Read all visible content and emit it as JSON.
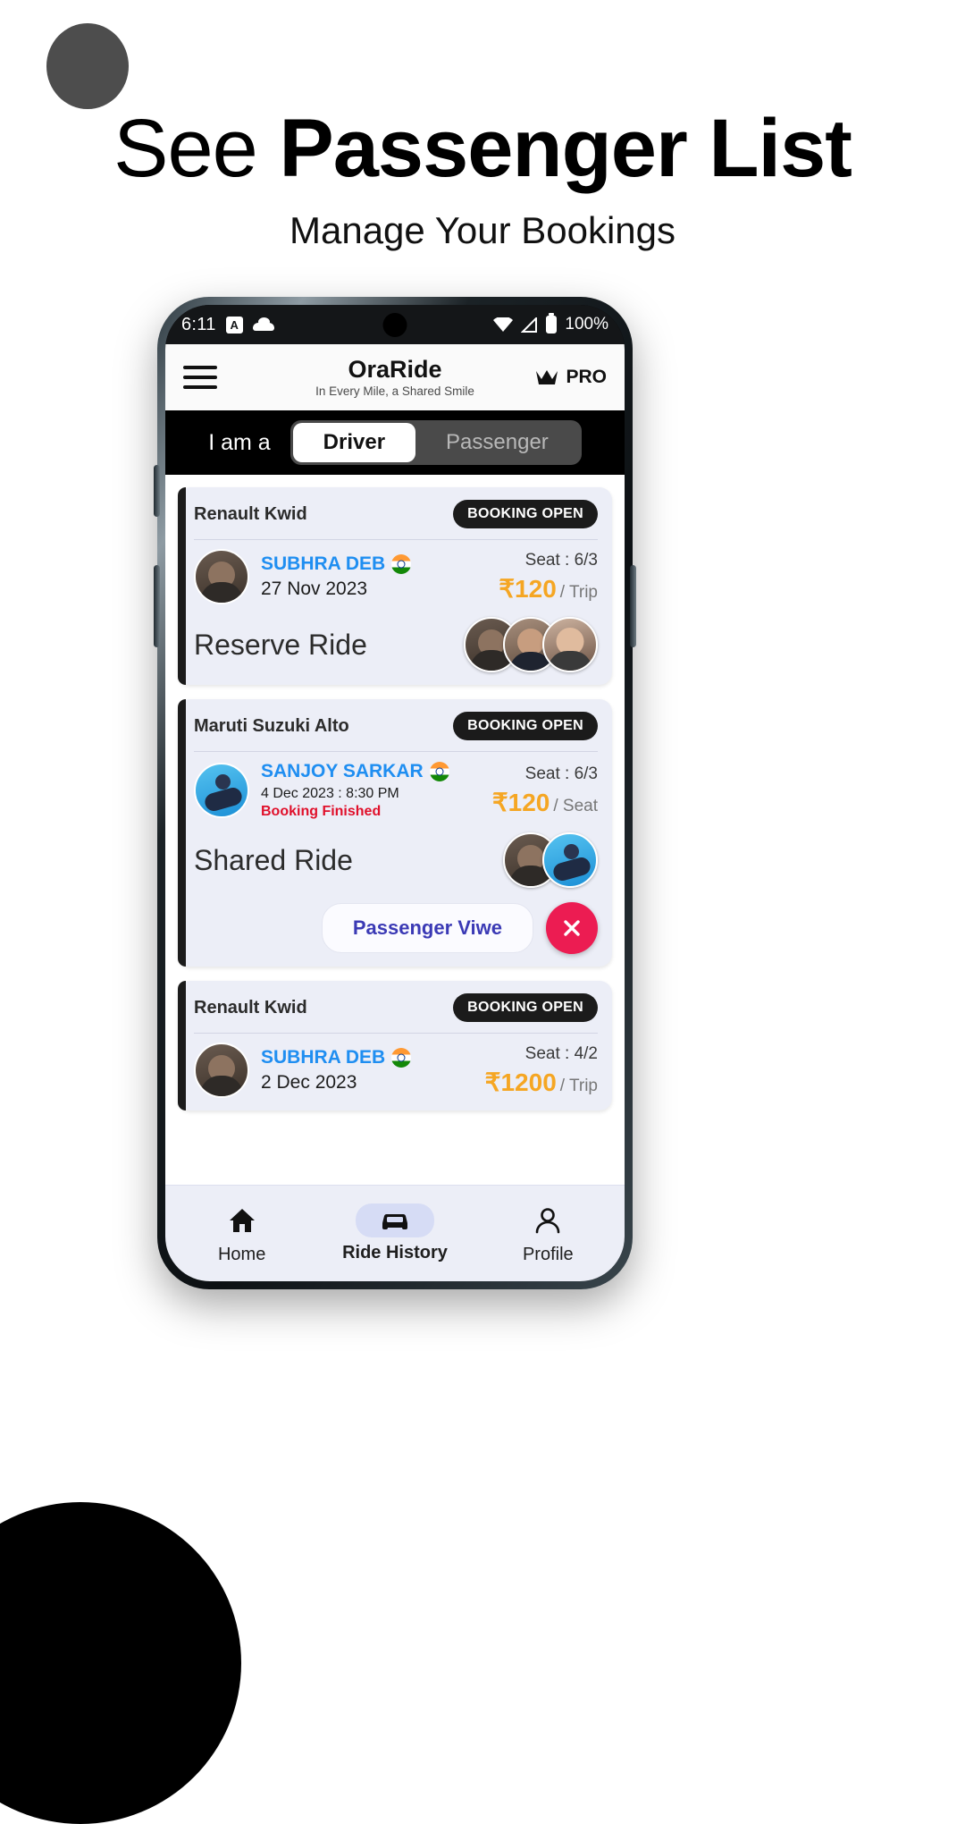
{
  "hero": {
    "title_light": "See ",
    "title_bold": "Passenger List",
    "subtitle": "Manage Your Bookings"
  },
  "statusbar": {
    "time": "6:11",
    "alarm_badge": "A",
    "battery": "100%",
    "icons": [
      "cloud-icon",
      "wifi-icon",
      "signal-icon",
      "battery-icon"
    ]
  },
  "appbar": {
    "brand": "OraRide",
    "tagline": "In Every Mile, a Shared Smile",
    "pro_label": "PRO"
  },
  "rolebar": {
    "prefix": "I am a",
    "options": [
      {
        "label": "Driver",
        "selected": true
      },
      {
        "label": "Passenger",
        "selected": false
      }
    ]
  },
  "cards": [
    {
      "car": "Renault Kwid",
      "status_badge": "BOOKING OPEN",
      "driver": "SUBHRA DEB",
      "date": "27 Nov 2023",
      "booking_state": "",
      "seat": "Seat : 6/3",
      "price": "₹120",
      "per": "/ Trip",
      "ride_type": "Reserve Ride",
      "avatar_count": 3
    },
    {
      "car": "Maruti Suzuki Alto",
      "status_badge": "BOOKING OPEN",
      "driver": "SANJOY SARKAR",
      "date": "4 Dec 2023 : 8:30 PM",
      "booking_state": "Booking Finished",
      "seat": "Seat : 6/3",
      "price": "₹120",
      "per": "/ Seat",
      "ride_type": "Shared Ride",
      "avatar_count": 2,
      "view_button": "Passenger Viwe"
    },
    {
      "car": "Renault Kwid",
      "status_badge": "BOOKING OPEN",
      "driver": "SUBHRA DEB",
      "date": "2 Dec 2023",
      "booking_state": "",
      "seat": "Seat : 4/2",
      "price": "₹1200",
      "per": "/ Trip",
      "ride_type": "",
      "avatar_count": 0
    }
  ],
  "bottomnav": [
    {
      "label": "Home",
      "icon": "home-icon",
      "active": false
    },
    {
      "label": "Ride History",
      "icon": "car-icon",
      "active": true
    },
    {
      "label": "Profile",
      "icon": "person-icon",
      "active": false
    }
  ],
  "colors": {
    "accent_blue": "#1f8ef1",
    "price_orange": "#f5a623",
    "alert_red": "#e0102b",
    "view_purple": "#3b3ab5",
    "close_pink": "#ec1c52"
  }
}
